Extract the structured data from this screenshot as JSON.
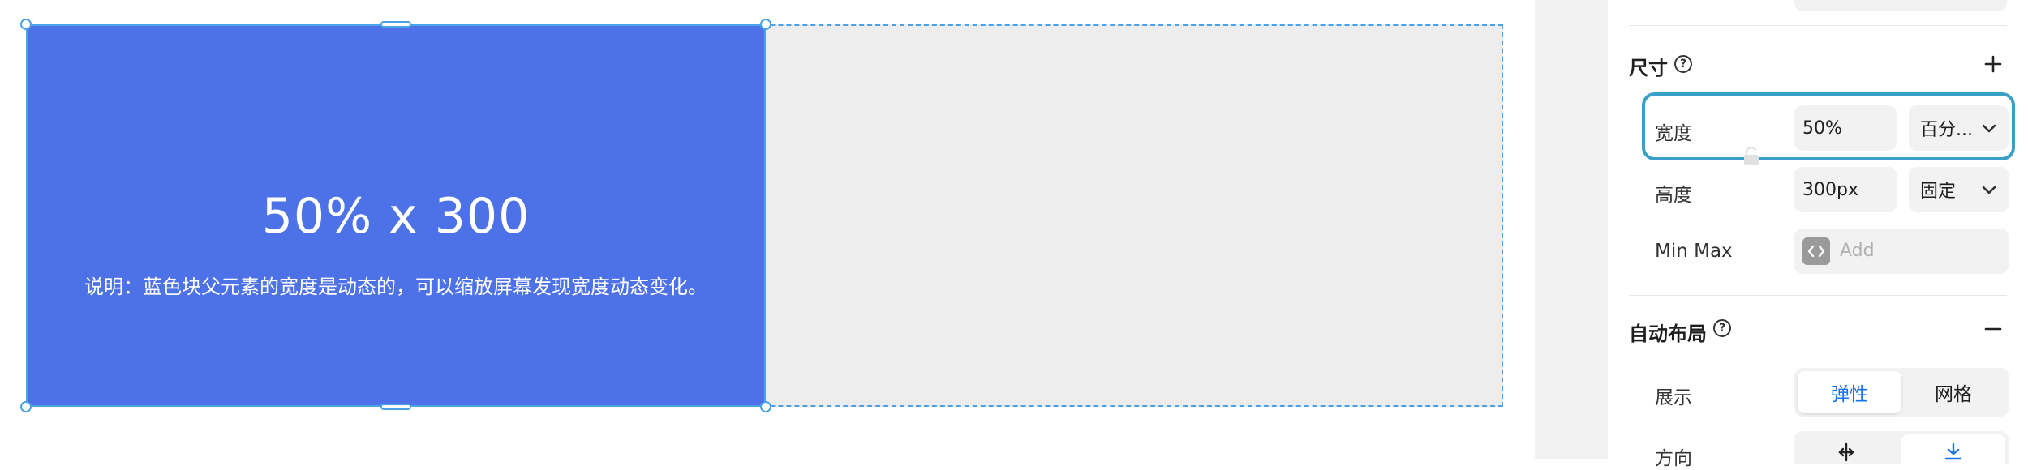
{
  "canvas": {
    "block": {
      "title": "50% x 300",
      "description": "说明：蓝色块父元素的宽度是动态的，可以缩放屏幕发现宽度动态变化。",
      "fill_color": "#4d72e8",
      "selection_color": "#4aa3e8"
    },
    "parent_fill_color": "#ededed"
  },
  "panel": {
    "size_section": {
      "title": "尺寸",
      "help_icon": "question-circle-icon",
      "add_icon": "plus-icon",
      "width": {
        "label": "宽度",
        "value": "50%",
        "mode": "百分..."
      },
      "height": {
        "label": "高度",
        "value": "300px",
        "mode": "固定"
      },
      "lock_icon": "unlock-icon",
      "minmax": {
        "label": "Min Max",
        "placeholder": "Add",
        "icon": "code-icon"
      }
    },
    "auto_layout_section": {
      "title": "自动布局",
      "help_icon": "question-circle-icon",
      "collapse_icon": "minus-icon",
      "display": {
        "label": "展示",
        "options": [
          "弹性",
          "网格"
        ],
        "selected": "弹性"
      },
      "direction": {
        "label": "方向"
      }
    },
    "highlight_color": "#3aa0c8",
    "accent_color": "#1a73e8"
  }
}
